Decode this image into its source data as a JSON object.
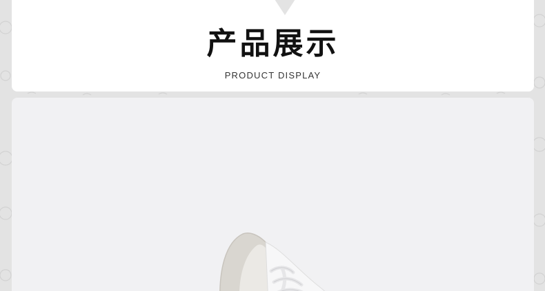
{
  "header": {
    "title": "产品展示",
    "subtitle": "PRODUCT DISPLAY"
  },
  "photo": {
    "subject": "sneaker"
  },
  "colors": {
    "background": "#e3e3e3",
    "card": "#ffffff",
    "photo_bg": "#f1f1f3",
    "title": "#111111"
  }
}
